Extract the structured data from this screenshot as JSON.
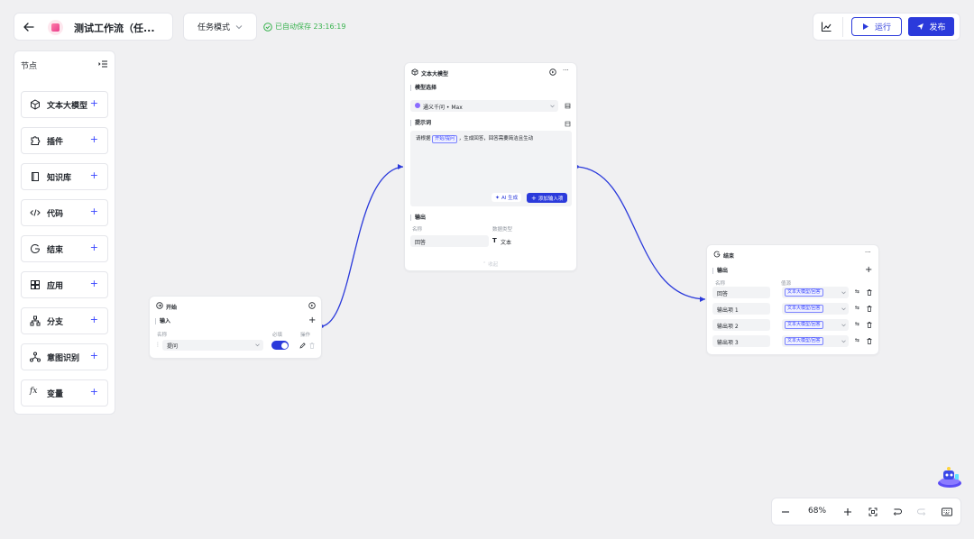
{
  "header": {
    "back_icon": "arrow-left-icon",
    "app_title": "测试工作流（任...",
    "mode_label": "任务模式",
    "autosave_text": "已自动保存 23:16:19",
    "run_label": "运行",
    "publish_label": "发布",
    "colors": {
      "accent": "#2b3adb",
      "success": "#37b24d"
    }
  },
  "sidebar": {
    "title": "节点",
    "items": [
      {
        "label": "文本大模型",
        "icon": "cube-icon"
      },
      {
        "label": "插件",
        "icon": "puzzle-icon"
      },
      {
        "label": "知识库",
        "icon": "book-icon"
      },
      {
        "label": "代码",
        "icon": "code-icon"
      },
      {
        "label": "结束",
        "icon": "end-icon"
      },
      {
        "label": "应用",
        "icon": "grid-icon"
      },
      {
        "label": "分支",
        "icon": "branch-icon"
      },
      {
        "label": "意图识别",
        "icon": "intent-icon"
      },
      {
        "label": "变量",
        "icon": "fx-icon"
      }
    ]
  },
  "start_node": {
    "title": "开始",
    "section_input": "输入",
    "col_name": "名称",
    "col_required": "必填",
    "col_action": "操作",
    "row_name": "提问",
    "required": true
  },
  "llm_node": {
    "title": "文本大模型",
    "section_model": "模型选择",
    "model_name": "通义千问 • Max",
    "section_prompt": "提示词",
    "prompt_prefix": "请根据",
    "prompt_tag": "开始/提问",
    "prompt_suffix": "，生成回答，回答需要简洁且生动",
    "ai_generate": "AI 生成",
    "add_input": "添加输入项",
    "section_output": "输出",
    "col_name": "名称",
    "col_type": "数据类型",
    "output_name": "回答",
    "output_type": "文本",
    "collapse": "收起"
  },
  "end_node": {
    "title": "结束",
    "section_output": "输出",
    "col_name": "名称",
    "col_source": "值源",
    "rows": [
      {
        "name": "回答",
        "source": "文本大模型/回答"
      },
      {
        "name": "输出项 1",
        "source": "文本大模型/回答"
      },
      {
        "name": "输出项 2",
        "source": "文本大模型/回答"
      },
      {
        "name": "输出项 3",
        "source": "文本大模型/回答"
      }
    ]
  },
  "zoom": {
    "level": "68%"
  }
}
